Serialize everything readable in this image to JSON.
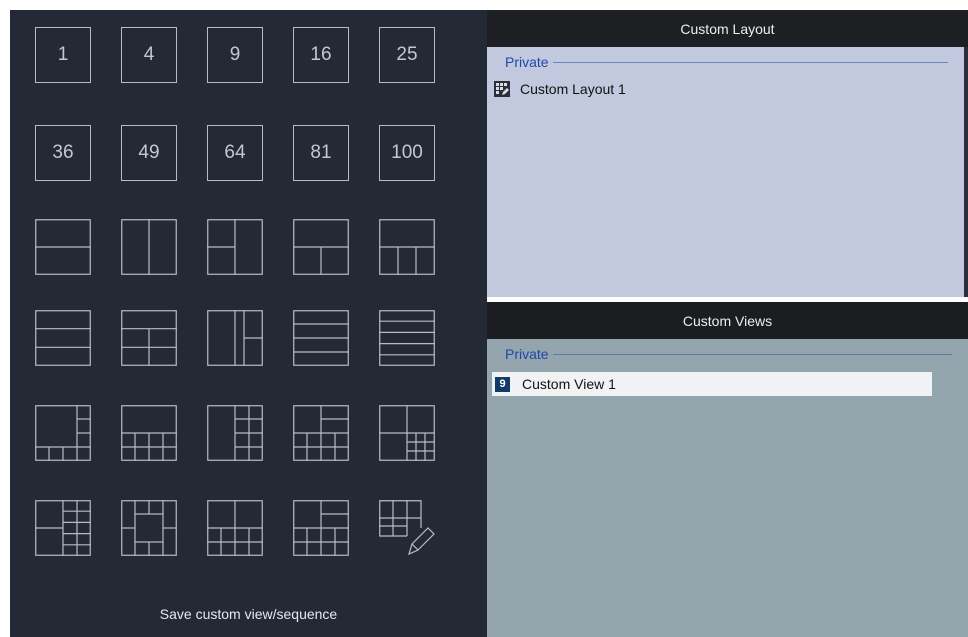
{
  "grid": {
    "numbers": [
      "1",
      "4",
      "9",
      "16",
      "25",
      "36",
      "49",
      "64",
      "81",
      "100"
    ],
    "save_label": "Save custom view/sequence"
  },
  "custom_layout": {
    "header": "Custom Layout",
    "group_label": "Private",
    "items": [
      {
        "label": "Custom Layout 1",
        "icon": "custom-layout-icon"
      }
    ]
  },
  "custom_views": {
    "header": "Custom Views",
    "group_label": "Private",
    "items": [
      {
        "label": "Custom View 1",
        "badge": "9",
        "icon": "view-count-badge"
      }
    ]
  },
  "colors": {
    "left_bg": "#242a35",
    "layout_bg": "#c2c9de",
    "views_bg": "#95a5ae",
    "group_text": "#2048a8",
    "header_bg": "#1e1f22"
  }
}
